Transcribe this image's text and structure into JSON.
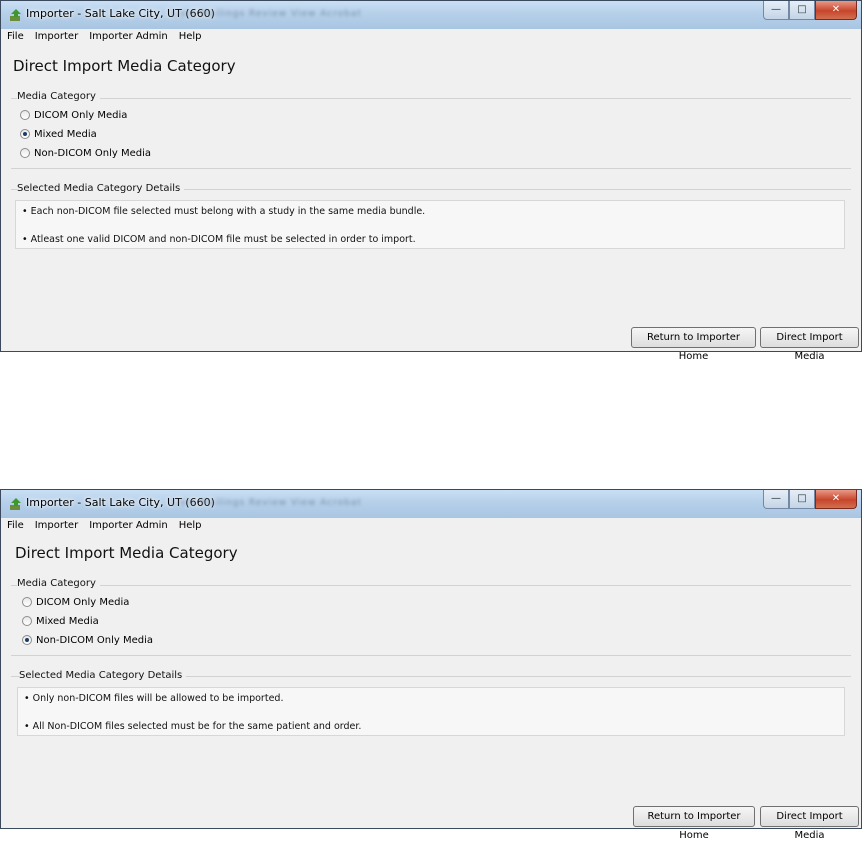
{
  "colors": {
    "titlebar": "#b6d0ea",
    "window_bg": "#f0f0f0",
    "close_button": "#c7452b"
  },
  "windows": [
    {
      "title": "Importer - Salt Lake City, UT (660)",
      "blurred_tabs": "Lists   Mailings   Review   View   Acrobat",
      "menu": [
        "File",
        "Importer",
        "Importer Admin",
        "Help"
      ],
      "heading": "Direct Import Media Category",
      "media_category_label": "Media Category",
      "options": [
        "DICOM Only Media",
        "Mixed Media",
        "Non-DICOM Only Media"
      ],
      "selected_option": "Mixed Media",
      "details_label": "Selected Media Category Details",
      "details": [
        "• Each non-DICOM file selected must belong with a study in the same media bundle.",
        "• Atleast one valid DICOM and non-DICOM file must be selected in order to import."
      ],
      "return_button": "Return to Importer Home",
      "import_button": "Direct Import Media"
    },
    {
      "title": "Importer - Salt Lake City, UT (660)",
      "blurred_tabs": "Lists   Mailings   Review   View   Acrobat",
      "menu": [
        "File",
        "Importer",
        "Importer Admin",
        "Help"
      ],
      "heading": "Direct Import Media Category",
      "media_category_label": "Media Category",
      "options": [
        "DICOM Only Media",
        "Mixed Media",
        "Non-DICOM Only Media"
      ],
      "selected_option": "Non-DICOM Only Media",
      "details_label": "Selected Media Category Details",
      "details": [
        "• Only non-DICOM files will be allowed to be imported.",
        "• All Non-DICOM files selected must be for the same patient and order."
      ],
      "return_button": "Return to Importer Home",
      "import_button": "Direct Import Media"
    }
  ]
}
